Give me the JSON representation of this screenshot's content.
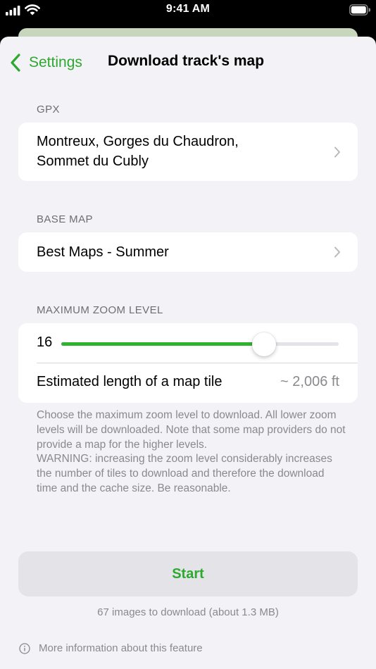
{
  "status_bar": {
    "time": "9:41 AM"
  },
  "nav": {
    "back_label": "Settings",
    "title": "Download track's map"
  },
  "gpx": {
    "header": "GPX",
    "track_line1": "Montreux, Gorges du Chaudron,",
    "track_line2": "Sommet du Cubly"
  },
  "base_map": {
    "header": "BASE MAP",
    "value": "Best Maps - Summer"
  },
  "zoom": {
    "header": "MAXIMUM ZOOM LEVEL",
    "value": "16",
    "slider_fraction": 0.73,
    "tile_label": "Estimated length of a map tile",
    "tile_value": "~ 2,006 ft"
  },
  "footnote": {
    "line1": "Choose the maximum zoom level to download. All lower zoom levels will be downloaded. Note that some map providers do not provide a map for the higher levels.",
    "line2": "WARNING: increasing the zoom level considerably increases the number of tiles to download and therefore the download time and the cache size. Be reasonable."
  },
  "actions": {
    "start_label": "Start",
    "summary": "67 images to download (about 1.3 MB)",
    "more_info": "More information about this feature"
  },
  "colors": {
    "accent": "#2fa82f",
    "slider_fill": "#2fb22f",
    "background": "#f2f2f7",
    "secondary_text": "#8a8a8e"
  },
  "icons": {
    "back": "chevron-left-icon",
    "row_disclosure": "chevron-right-icon",
    "info": "info-circle-icon",
    "signal": "cellular-signal-icon",
    "wifi": "wifi-icon",
    "battery": "battery-icon"
  }
}
